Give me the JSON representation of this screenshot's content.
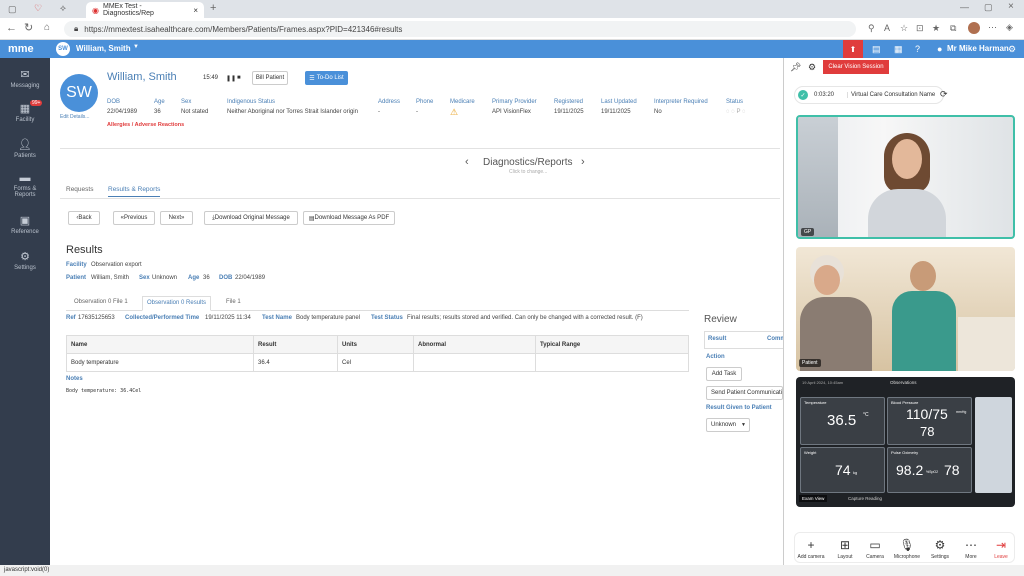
{
  "browser": {
    "tab_title": "MMEx Test - Diagnostics/Rep",
    "url": "https://mmextest.isahealthcare.com/Members/Patients/Frames.aspx?PID=421346#results"
  },
  "header": {
    "logo": "mme",
    "patient_initials_badge": "SW",
    "patient_name": "William, Smith",
    "user_name": "Mr Mike Harman"
  },
  "sidebar": {
    "items": [
      {
        "label": "Messaging",
        "icon": "mail-icon"
      },
      {
        "label": "Facility",
        "icon": "building-icon",
        "badge": "99+"
      },
      {
        "label": "Patients",
        "icon": "person-icon"
      },
      {
        "label": "Forms & Reports",
        "icon": "folder-icon"
      },
      {
        "label": "Reference",
        "icon": "book-icon"
      },
      {
        "label": "Settings",
        "icon": "gear-icon"
      }
    ]
  },
  "patient": {
    "initials": "SW",
    "name": "William, Smith",
    "time": "15:49",
    "bill_label": "Bill Patient",
    "todo_label": "To-Do List",
    "edit_details": "Edit Details...",
    "allergies": "Allergies / Adverse Reactions",
    "fields": [
      {
        "label": "DOB",
        "value": "22/04/1989"
      },
      {
        "label": "Age",
        "value": "36"
      },
      {
        "label": "Sex",
        "value": "Not stated"
      },
      {
        "label": "Indigenous Status",
        "value": "Neither Aboriginal nor Torres Strait Islander origin"
      },
      {
        "label": "Address",
        "value": "-"
      },
      {
        "label": "Phone",
        "value": "-"
      },
      {
        "label": "Medicare",
        "value": ""
      },
      {
        "label": "Primary Provider",
        "value": "API VisionFlex"
      },
      {
        "label": "Registered",
        "value": "19/11/2025"
      },
      {
        "label": "Last Updated",
        "value": "19/11/2025"
      },
      {
        "label": "Interpreter Required",
        "value": "No"
      },
      {
        "label": "Status",
        "value": ""
      }
    ]
  },
  "page_nav": {
    "title": "Diagnostics/Reports",
    "hint": "Click to change..."
  },
  "tabs": [
    "Requests",
    "Results & Reports"
  ],
  "toolbar": {
    "back": "Back",
    "previous": "Previous",
    "next": "Next",
    "download_original": "Download Original Message",
    "download_pdf": "Download Message As PDF"
  },
  "results": {
    "heading": "Results",
    "facility_label": "Facility",
    "facility_value": "Observation export",
    "patient_label": "Patient",
    "patient_value": "William, Smith",
    "sex_label": "Sex",
    "sex_value": "Unknown",
    "age_label": "Age",
    "age_value": "36",
    "dob_label": "DOB",
    "dob_value": "22/04/1989",
    "subtabs": [
      "Observation 0 File 1",
      "Observation 0 Results",
      "File 1"
    ],
    "ref_label": "Ref",
    "ref_value": "17635125653",
    "collected_label": "Collected/Performed Time",
    "collected_value": "19/11/2025 11:34",
    "testname_label": "Test Name",
    "testname_value": "Body temperature panel",
    "teststatus_label": "Test Status",
    "teststatus_value": "Final results; results stored and verified. Can only be changed with a corrected result. (F)",
    "columns": [
      "Name",
      "Result",
      "Units",
      "Abnormal",
      "Typical Range"
    ],
    "rows": [
      [
        "Body temperature",
        "36.4",
        "Cel",
        "",
        ""
      ]
    ],
    "notes_label": "Notes",
    "notes_text": "Body temperature: 36.4Cel"
  },
  "review": {
    "heading": "Review",
    "col_result": "Result",
    "col_comm": "Comm",
    "action_label": "Action",
    "add_task": "Add Task",
    "send_comm": "Send Patient Communicati",
    "result_given": "Result Given to Patient",
    "select_value": "Unknown"
  },
  "vision": {
    "clear_session": "Clear Vision Session",
    "timer": "0:03:20",
    "room_name": "Virtual Care Consultation Name",
    "tile1_tag": "GP",
    "tile2_tag": "Patient",
    "tile3_tag": "Exam View",
    "tile3_capture": "Capture Reading",
    "device_header": "Observations",
    "device_date": "19 April 2024, 10:45am",
    "readings": [
      {
        "label": "Temperature",
        "value": "36.5",
        "unit": "°C"
      },
      {
        "label": "Blood Pressure",
        "value": "110/75",
        "value2": "78",
        "unit": "mmHg"
      },
      {
        "label": "Weight",
        "value": "74",
        "unit": "kg"
      },
      {
        "label": "Pulse Oximetry",
        "value": "98.2",
        "value2": "78",
        "unit": "%SpO2"
      }
    ],
    "controls": [
      "Add camera",
      "Layout",
      "Camera",
      "Microphone",
      "Settings",
      "More",
      "Leave"
    ]
  },
  "statusbar": {
    "text": "javascript:void(0)"
  },
  "colors": {
    "header_blue": "#4a90d9",
    "sidebar_dark": "#333d4d",
    "danger_red": "#e03c3c",
    "accent_teal": "#3fbfa8"
  }
}
